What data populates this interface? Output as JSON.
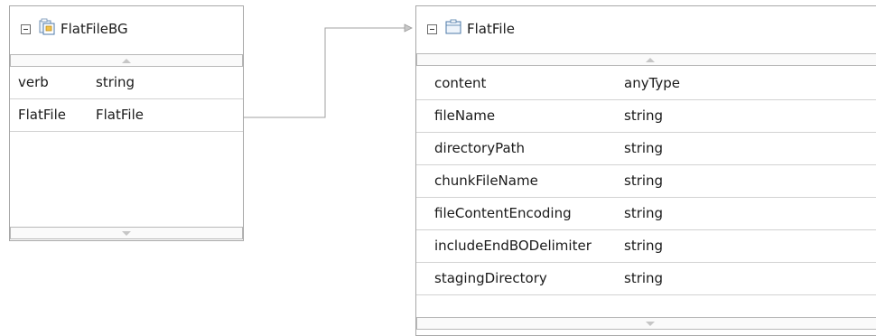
{
  "left_bo": {
    "title": "FlatFileBG",
    "icon": "business-graph-icon",
    "fields": [
      {
        "name": "verb",
        "type": "string"
      },
      {
        "name": "FlatFile",
        "type": "FlatFile"
      }
    ]
  },
  "right_bo": {
    "title": "FlatFile",
    "icon": "business-object-icon",
    "fields": [
      {
        "name": "content",
        "type": "anyType"
      },
      {
        "name": "fileName",
        "type": "string"
      },
      {
        "name": "directoryPath",
        "type": "string"
      },
      {
        "name": "chunkFileName",
        "type": "string"
      },
      {
        "name": "fileContentEncoding",
        "type": "string"
      },
      {
        "name": "includeEndBODelimiter",
        "type": "string"
      },
      {
        "name": "stagingDirectory",
        "type": "string"
      }
    ]
  },
  "colors": {
    "border": "#a8a8a8",
    "row_separator": "#d2d2d2",
    "connector": "#a0a0a0"
  }
}
